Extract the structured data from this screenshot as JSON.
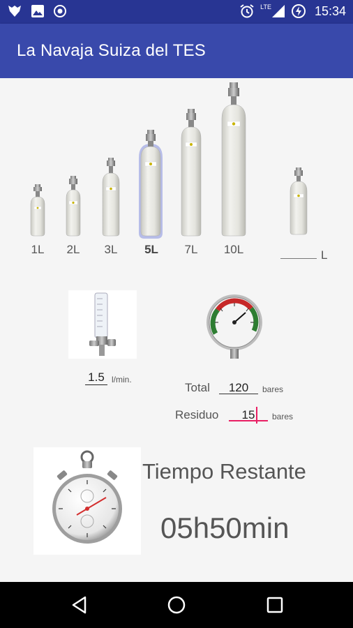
{
  "status_bar": {
    "time": "15:34",
    "network_label": "LTE",
    "icons": [
      "app-notification-icon",
      "image-icon",
      "record-icon",
      "alarm-icon",
      "signal-icon",
      "battery-charging-icon"
    ]
  },
  "app_bar": {
    "title": "La Navaja Suiza del TES"
  },
  "cylinders": {
    "sizes": [
      "1L",
      "2L",
      "3L",
      "5L",
      "7L",
      "10L"
    ],
    "selected": "5L",
    "custom_unit": "L",
    "custom_value": ""
  },
  "flow": {
    "value": "1.5",
    "unit": "l/min."
  },
  "pressure": {
    "total_label": "Total",
    "total_value": "120",
    "total_unit": "bares",
    "residue_label": "Residuo",
    "residue_value": "15",
    "residue_unit": "bares"
  },
  "result": {
    "title": "Tiempo Restante",
    "value": "05h50min"
  },
  "nav_bar": {
    "icons": [
      "back-icon",
      "home-icon",
      "recents-icon"
    ]
  },
  "colors": {
    "status_bar": "#283593",
    "app_bar": "#3949ab",
    "accent": "#e91e63",
    "background": "#f5f5f5"
  }
}
